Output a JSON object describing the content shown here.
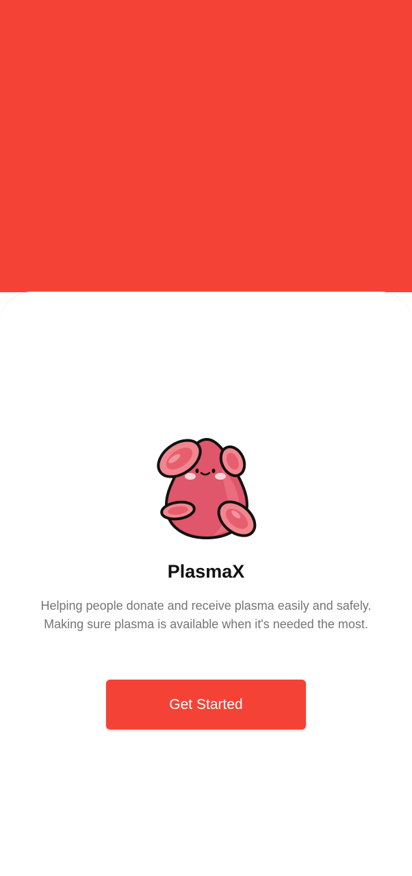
{
  "app": {
    "name": "PlasmaX",
    "description": "Helping people donate and receive plasma easily and safely. Making sure plasma is available when it's needed the most."
  },
  "actions": {
    "get_started_label": "Get Started"
  },
  "icons": {
    "logo": "blood-cell-mascot-icon"
  },
  "colors": {
    "brand": "#F44336",
    "mascot_body": "#E0566A",
    "cell": "#F2868F",
    "text_primary": "#111111",
    "text_secondary": "#757575"
  }
}
